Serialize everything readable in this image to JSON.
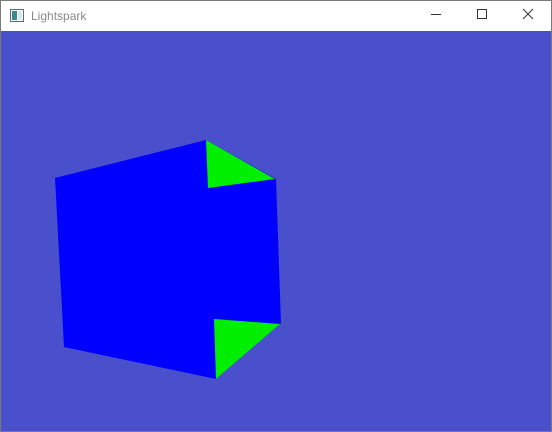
{
  "window": {
    "title": "Lightspark",
    "app_icon": "window-app-icon",
    "controls": {
      "minimize_icon": "minimize-icon",
      "maximize_icon": "maximize-icon",
      "close_icon": "close-icon"
    }
  },
  "stage": {
    "background_color": "#4a4fcb",
    "cube_face_color": "#0000ff",
    "triangle_color": "#00ee00"
  }
}
